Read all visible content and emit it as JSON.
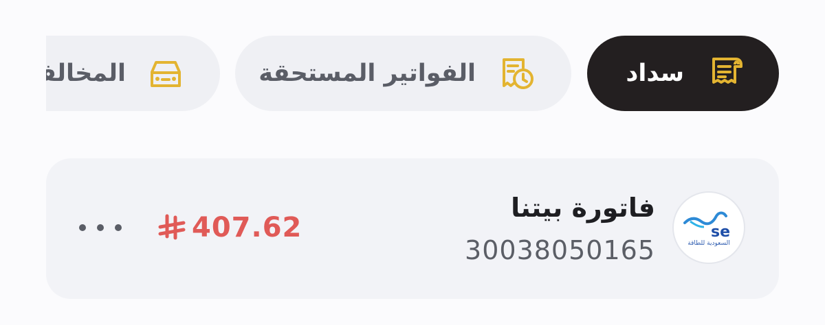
{
  "tabs": [
    {
      "label": "سداد",
      "icon": "receipt-icon",
      "active": true
    },
    {
      "label": "الفواتير المستحقة",
      "icon": "bill-clock-icon",
      "active": false
    },
    {
      "label": "المخالفات",
      "icon": "car-icon",
      "active": false
    }
  ],
  "bill": {
    "title": "فاتورة بيتنا",
    "number": "30038050165",
    "amount": "407.62",
    "currency_icon": "riyal-icon",
    "amount_color": "#e05a57",
    "provider": {
      "logo_text": "se",
      "logo_subtitle": "السعودية للطاقة"
    }
  },
  "colors": {
    "accent": "#e3b431",
    "active_tab": "#231f20"
  }
}
